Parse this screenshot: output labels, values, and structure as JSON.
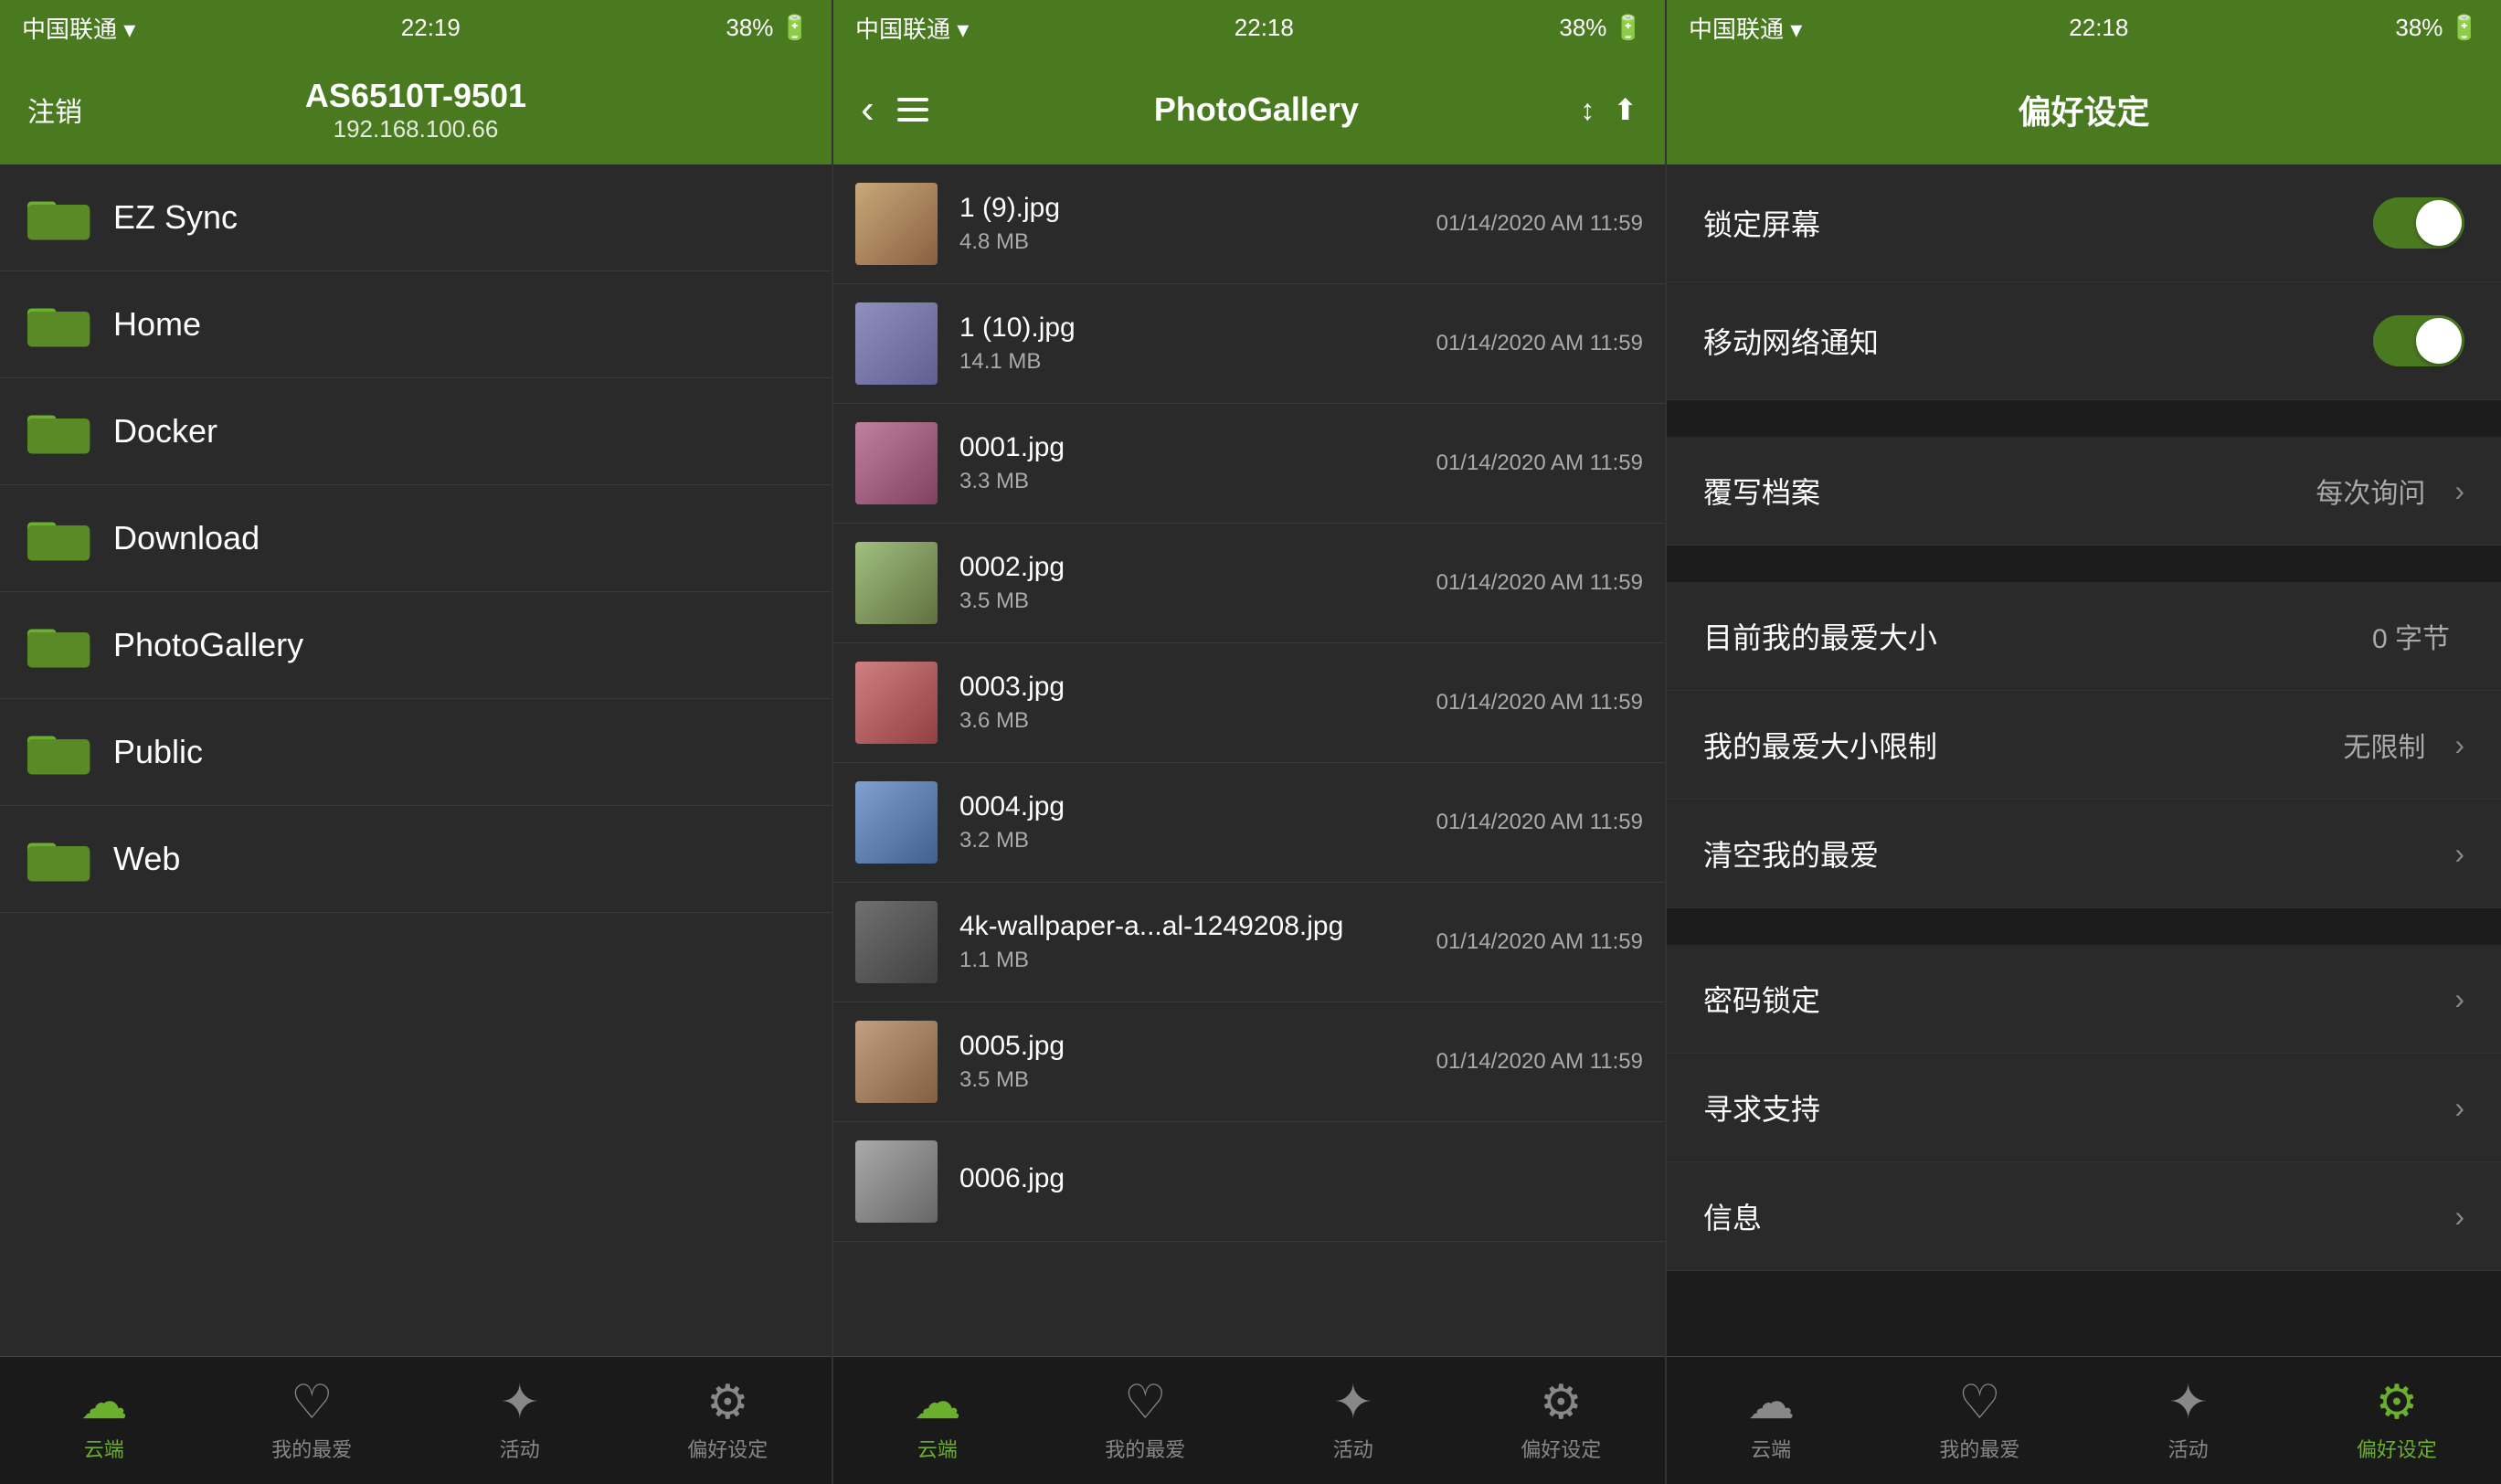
{
  "panels": {
    "left": {
      "statusBar": {
        "carrier": "中国联通 ▾",
        "wifi": "WiFi",
        "time": "22:19",
        "battery": "38% 🔋"
      },
      "header": {
        "cancelBtn": "注销",
        "title": "AS6510T-9501",
        "subtitle": "192.168.100.66"
      },
      "files": [
        {
          "name": "EZ Sync"
        },
        {
          "name": "Home"
        },
        {
          "name": "Docker"
        },
        {
          "name": "Download"
        },
        {
          "name": "PhotoGallery"
        },
        {
          "name": "Public"
        },
        {
          "name": "Web"
        }
      ],
      "tabs": [
        {
          "label": "云端",
          "active": true
        },
        {
          "label": "我的最爱",
          "active": false
        },
        {
          "label": "活动",
          "active": false
        },
        {
          "label": "偏好设定",
          "active": false
        }
      ]
    },
    "mid": {
      "statusBar": {
        "carrier": "中国联通 ▾",
        "wifi": "WiFi",
        "time": "22:18",
        "battery": "38% 🔋"
      },
      "header": {
        "title": "PhotoGallery"
      },
      "photos": [
        {
          "name": "1 (9).jpg",
          "size": "4.8 MB",
          "date": "01/14/2020 AM 11:59"
        },
        {
          "name": "1 (10).jpg",
          "size": "14.1 MB",
          "date": "01/14/2020 AM 11:59"
        },
        {
          "name": "0001.jpg",
          "size": "3.3 MB",
          "date": "01/14/2020 AM 11:59"
        },
        {
          "name": "0002.jpg",
          "size": "3.5 MB",
          "date": "01/14/2020 AM 11:59"
        },
        {
          "name": "0003.jpg",
          "size": "3.6 MB",
          "date": "01/14/2020 AM 11:59"
        },
        {
          "name": "0004.jpg",
          "size": "3.2 MB",
          "date": "01/14/2020 AM 11:59"
        },
        {
          "name": "4k-wallpaper-a...al-1249208.jpg",
          "size": "1.1 MB",
          "date": "01/14/2020 AM 11:59"
        },
        {
          "name": "0005.jpg",
          "size": "3.5 MB",
          "date": "01/14/2020 AM 11:59"
        },
        {
          "name": "0006.jpg",
          "size": "",
          "date": ""
        }
      ],
      "tabs": [
        {
          "label": "云端",
          "active": true
        },
        {
          "label": "我的最爱",
          "active": false
        },
        {
          "label": "活动",
          "active": false
        },
        {
          "label": "偏好设定",
          "active": false
        }
      ]
    },
    "right": {
      "statusBar": {
        "carrier": "中国联通 ▾",
        "wifi": "WiFi",
        "time": "22:18",
        "battery": "38% 🔋"
      },
      "header": {
        "title": "偏好设定"
      },
      "settings": [
        {
          "group": "toggles",
          "items": [
            {
              "label": "锁定屏幕",
              "type": "toggle",
              "value": true
            },
            {
              "label": "移动网络通知",
              "type": "toggle",
              "value": true
            }
          ]
        },
        {
          "group": "overwrite",
          "items": [
            {
              "label": "覆写档案",
              "type": "value-chevron",
              "value": "每次询问"
            }
          ]
        },
        {
          "group": "favorites",
          "items": [
            {
              "label": "目前我的最爱大小",
              "type": "value",
              "value": "0 字节"
            },
            {
              "label": "我的最爱大小限制",
              "type": "value-chevron",
              "value": "无限制"
            },
            {
              "label": "清空我的最爱",
              "type": "chevron",
              "value": ""
            }
          ]
        },
        {
          "group": "more",
          "items": [
            {
              "label": "密码锁定",
              "type": "chevron",
              "value": ""
            },
            {
              "label": "寻求支持",
              "type": "chevron",
              "value": ""
            },
            {
              "label": "信息",
              "type": "chevron",
              "value": ""
            }
          ]
        }
      ],
      "tabs": [
        {
          "label": "云端",
          "active": false
        },
        {
          "label": "我的最爱",
          "active": false
        },
        {
          "label": "活动",
          "active": false
        },
        {
          "label": "偏好设定",
          "active": true
        }
      ]
    }
  }
}
